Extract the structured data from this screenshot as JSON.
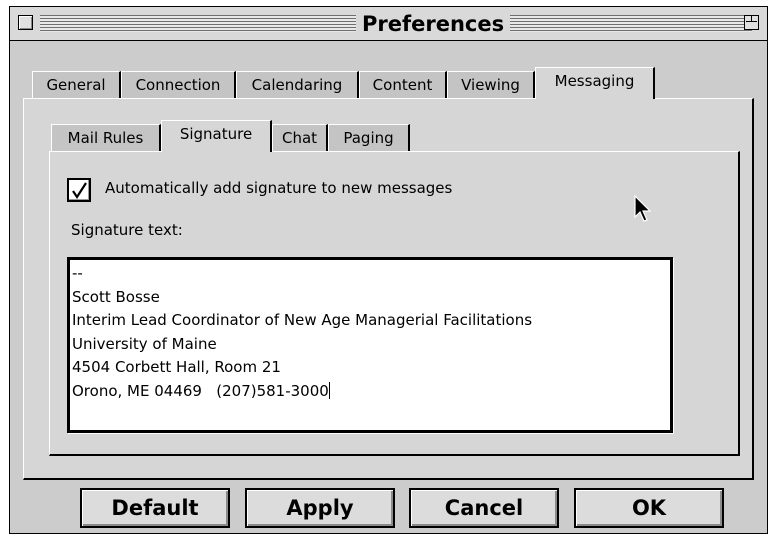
{
  "window": {
    "title": "Preferences"
  },
  "tabs": {
    "main": [
      "General",
      "Connection",
      "Calendaring",
      "Content",
      "Viewing",
      "Messaging"
    ],
    "main_active": "Messaging",
    "sub": [
      "Mail Rules",
      "Signature",
      "Chat",
      "Paging"
    ],
    "sub_active": "Signature"
  },
  "signature": {
    "auto_add_label": "Automatically add signature to new messages",
    "auto_add_checked": true,
    "text_label": "Signature text:",
    "lines": [
      "--",
      "Scott Bosse",
      "Interim Lead Coordinator of New Age Managerial Facilitations",
      "University of Maine",
      "4504 Corbett Hall, Room 21",
      "Orono, ME 04469   (207)581-3000"
    ]
  },
  "buttons": {
    "default": "Default",
    "apply": "Apply",
    "cancel": "Cancel",
    "ok": "OK"
  },
  "icons": {
    "close": "close-box-icon",
    "zoom": "zoom-box-icon",
    "check": "checkmark-icon",
    "cursor": "arrow-cursor-icon"
  }
}
